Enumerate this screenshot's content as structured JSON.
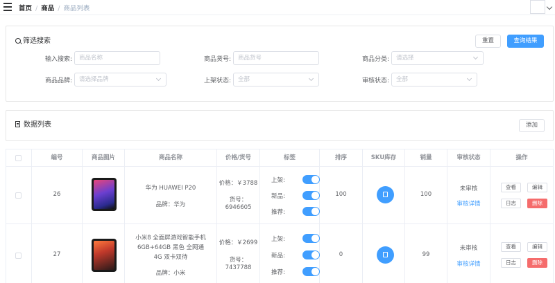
{
  "breadcrumb": {
    "home": "首页",
    "section": "商品",
    "current": "商品列表"
  },
  "filter": {
    "title": "筛选搜索",
    "reset_label": "重置",
    "query_label": "查询结果",
    "fields": [
      {
        "label": "输入搜索:",
        "placeholder": "商品名称",
        "kind": "input"
      },
      {
        "label": "商品货号:",
        "placeholder": "商品货号",
        "kind": "input"
      },
      {
        "label": "商品分类:",
        "placeholder": "请选择",
        "kind": "select"
      },
      {
        "label": "商品品牌:",
        "placeholder": "请选择品牌",
        "kind": "select"
      },
      {
        "label": "上架状态:",
        "placeholder": "全部",
        "kind": "select"
      },
      {
        "label": "审核状态:",
        "placeholder": "全部",
        "kind": "select"
      }
    ]
  },
  "list": {
    "title": "数据列表",
    "add_label": "添加"
  },
  "table": {
    "headers": [
      "编号",
      "商品图片",
      "商品名称",
      "价格/货号",
      "标签",
      "排序",
      "SKU库存",
      "销量",
      "审核状态",
      "操作"
    ],
    "tag_labels": {
      "publish": "上架:",
      "new": "新品:",
      "recommend": "推荐:"
    },
    "actions": {
      "view": "查看",
      "edit": "编辑",
      "log": "日志",
      "delete": "删除"
    },
    "rows": [
      {
        "id": "26",
        "name_lines": [
          "华为 HUAWEI P20"
        ],
        "brand": "品牌：华为",
        "price": "价格：￥3788",
        "sn_label": "货号：",
        "sn": "6946605",
        "publish": true,
        "new": true,
        "recommend": true,
        "sort": "100",
        "sales": "100",
        "audit_status": "未审核",
        "audit_detail": "审核详情"
      },
      {
        "id": "27",
        "name_lines": [
          "小米8 全面屏游戏智能手机",
          "6GB+64GB 黑色 全网通",
          "4G 双卡双待"
        ],
        "brand": "品牌：小米",
        "price": "价格：￥2699",
        "sn_label": "货号：",
        "sn": "7437788",
        "publish": true,
        "new": true,
        "recommend": true,
        "sort": "0",
        "sales": "99",
        "audit_status": "未审核",
        "audit_detail": "审核详情"
      }
    ]
  },
  "colors": {
    "primary": "#409eff",
    "danger": "#f56c6c",
    "text": "#606266"
  },
  "icons": [
    "menu-icon",
    "search-icon",
    "doc-icon",
    "edit-icon",
    "chevron-down-icon"
  ]
}
